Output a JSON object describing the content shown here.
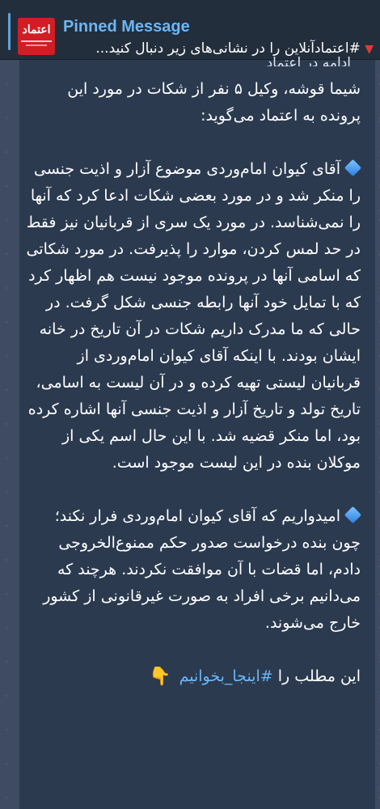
{
  "pinned": {
    "title": "Pinned Message",
    "text": "#اعتمادآنلاین را در نشانی‌های زیر دنبال کنید...",
    "thumb_logo": "اعتماد",
    "accent_color": "#6cb6f5"
  },
  "message": {
    "cutoff_line": "ادامه در اعتماد",
    "intro": "شیما قوشه، وکیل ۵ نفر از شکات در مورد این پرونده به اعتماد می‌گوید:",
    "paragraph_1": "آقای کیوان امام‌وردی موضوع آزار و اذیت جنسی را منکر شد و در مورد بعضی شکات ادعا کرد که آنها را نمی‌شناسد. در مورد یک سری از قربانیان نیز فقط در حد لمس کردن، موارد را پذیرفت. در مورد شکاتی که اسامی آنها در پرونده موجود نیست هم اظهار کرد که با تمایل خود آنها رابطه جنسی شکل گرفت. در حالی که ما مدرک داریم شکات در آن تاریخ در خانه ایشان بودند. با اینکه آقای کیوان امام‌وردی از قربانیان لیستی تهیه کرده و در آن لیست به اسامی، تاریخ تولد و تاریخ آزار و اذیت جنسی آنها اشاره کرده بود، اما منکر قضیه شد. با این حال اسم یکی از موکلان بنده در این لیست موجود است.",
    "paragraph_2": "امیدواریم که آقای کیوان امام‌وردی فرار نکند؛ چون بنده درخواست صدور حکم ممنوع‌الخروجی دادم، اما قضات با آن موافقت نکردند. هرچند که می‌دانیم برخی افراد به صورت غیرقانونی از کشور خارج می‌شوند.",
    "footer_prefix": "این مطلب را",
    "footer_hashtag": "#اینجا_بخوانیم",
    "hand_icon": "👇",
    "bullet_icon": "blue-diamond-icon",
    "bubble_color": "#2b3a4f",
    "link_color": "#6cb6f5"
  }
}
